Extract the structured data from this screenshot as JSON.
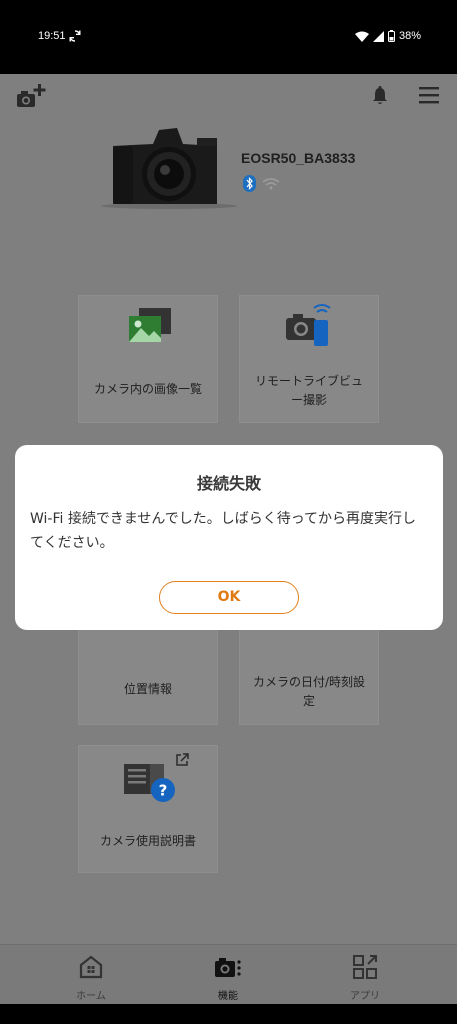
{
  "status_bar": {
    "time": "19:51",
    "battery": "38%"
  },
  "camera": {
    "name": "EOSR50_BA3833"
  },
  "tiles": [
    {
      "label": "カメラ内の画像一覧"
    },
    {
      "label": "リモートライブビュ\nー撮影"
    },
    {
      "label": "位置情報"
    },
    {
      "label": "カメラの日付/時刻設\n定"
    },
    {
      "label": "カメラ使用説明書"
    }
  ],
  "bottom_nav": [
    {
      "label": "ホーム"
    },
    {
      "label": "機能"
    },
    {
      "label": "アプリ"
    }
  ],
  "dialog": {
    "title": "接続失敗",
    "message": "Wi-Fi 接続できませんでした。しばらく待ってから再度実行してください。",
    "ok_label": "OK"
  },
  "colors": {
    "accent": "#e07a12",
    "bluetooth": "#1e6fc0",
    "overlay": "#7f7f7f"
  }
}
